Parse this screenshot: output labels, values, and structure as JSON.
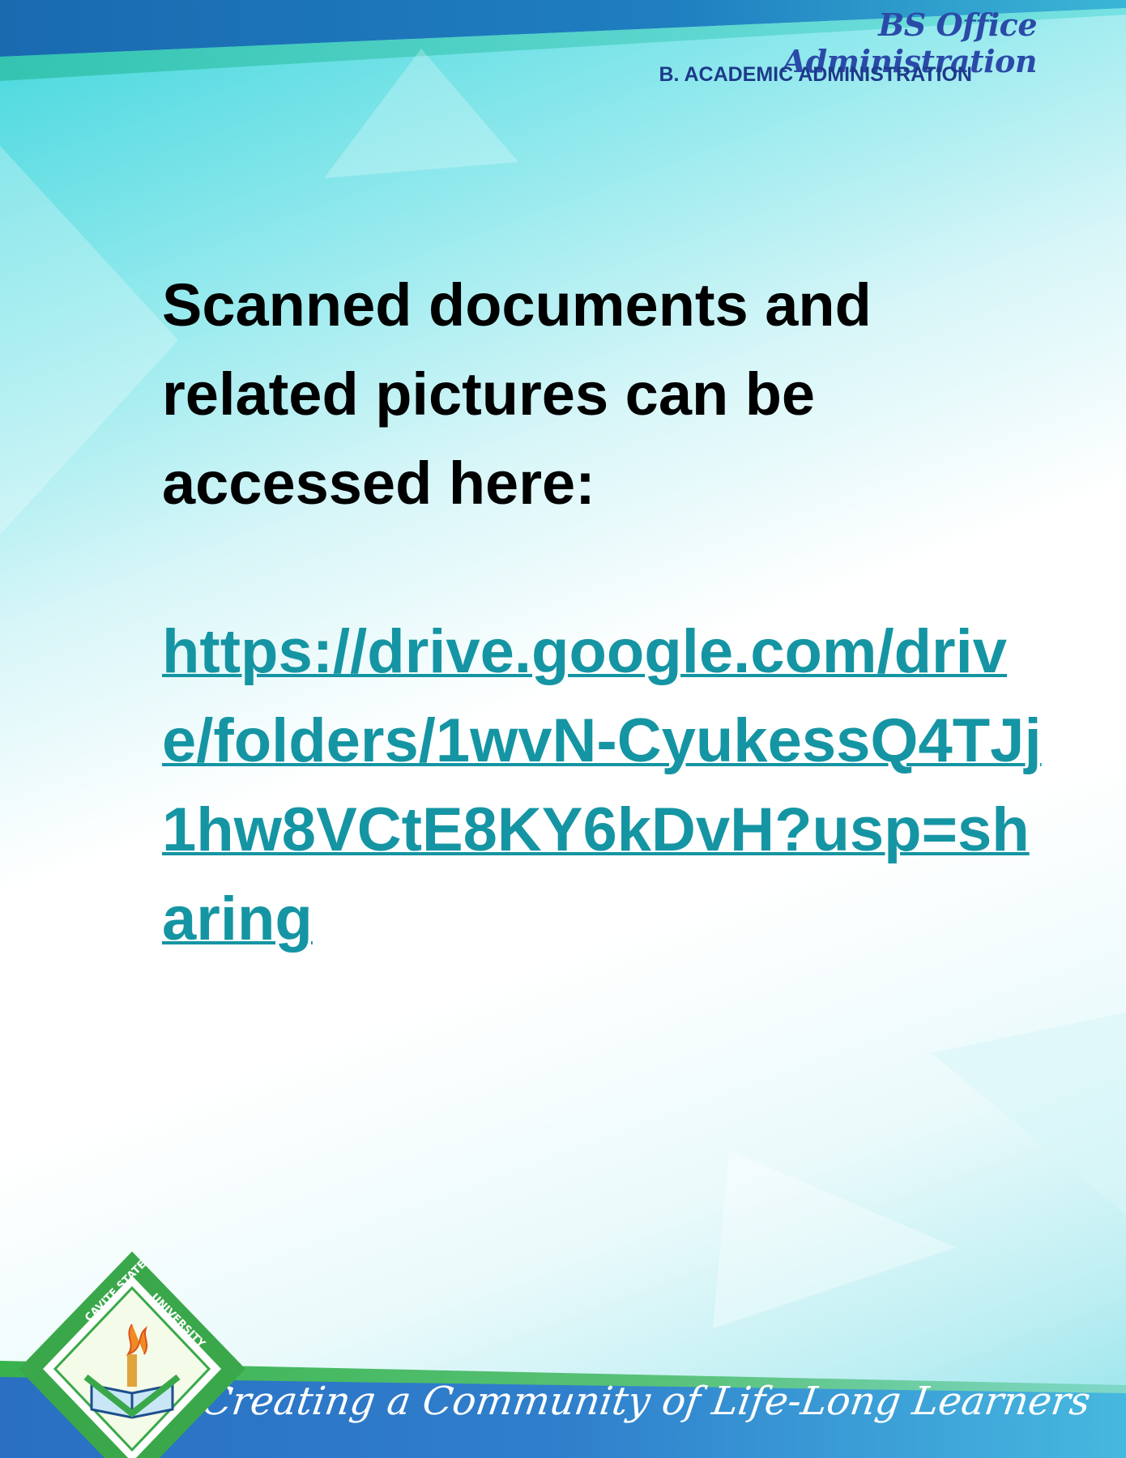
{
  "header": {
    "program": "BS Office Administration",
    "section": "B. ACADEMIC ADMINISTRATION"
  },
  "main": {
    "intro": "Scanned documents and related pictures can be accessed here:",
    "link_text": "https://drive.google.com/drive/folders/1wvN-CyukessQ4TJj1hw8VCtE8KY6kDvH?usp=sharing"
  },
  "footer": {
    "motto": "Creating a Community of Life-Long Learners",
    "logo_text": "CAVITE STATE UNIVERSITY"
  },
  "colors": {
    "header_band": "#1b6fb3",
    "footer_band": "#2a73c4",
    "link": "#1595a3",
    "logo_green": "#3aa84a"
  }
}
